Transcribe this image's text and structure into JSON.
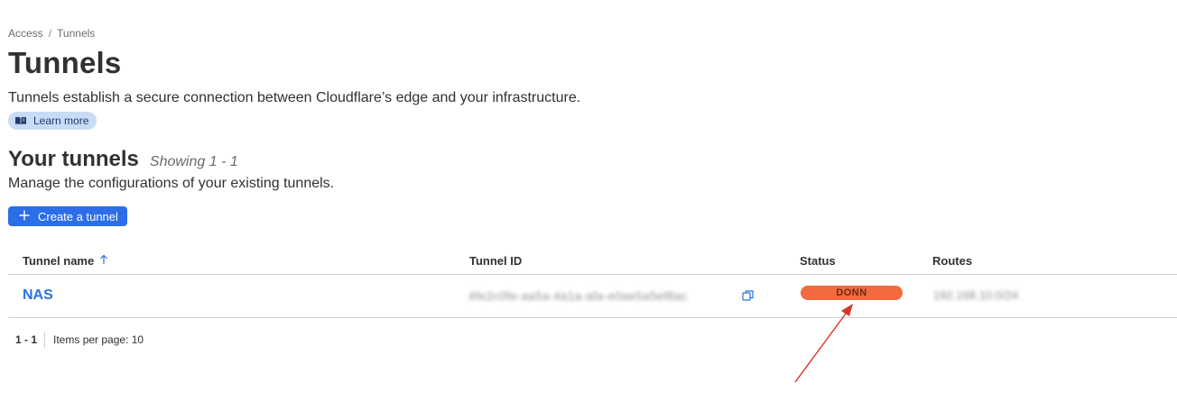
{
  "breadcrumb": {
    "parent": "Access",
    "separator": "/",
    "current": "Tunnels"
  },
  "header": {
    "title": "Tunnels",
    "description": "Tunnels establish a secure connection between Cloudflare’s edge and your infrastructure.",
    "learn_more_label": "Learn more",
    "learn_more_icon": "book-icon"
  },
  "section": {
    "title": "Your tunnels",
    "showing": "Showing 1 - 1",
    "description": "Manage the configurations of your existing tunnels.",
    "create_button_label": "Create a tunnel",
    "create_button_icon": "plus-icon"
  },
  "table": {
    "columns": {
      "name": "Tunnel name",
      "sort_icon": "arrow-up-icon",
      "id": "Tunnel ID",
      "status": "Status",
      "routes": "Routes"
    },
    "rows": [
      {
        "name": "NAS",
        "id": "4fe2c0fe-aa5a-4a1a-afa-e0ae5a5ef8ac",
        "copy_icon": "copy-icon",
        "status": "DONN",
        "routes": "192.168.10.0/24"
      }
    ]
  },
  "pagination": {
    "range": "1 - 1",
    "items_per_page": "Items per page: 10"
  },
  "colors": {
    "accent": "#2c6ee8",
    "status_down": "#f26a3d",
    "learn_more_bg": "#c8dcf6",
    "annotation_arrow": "#d9342b"
  }
}
